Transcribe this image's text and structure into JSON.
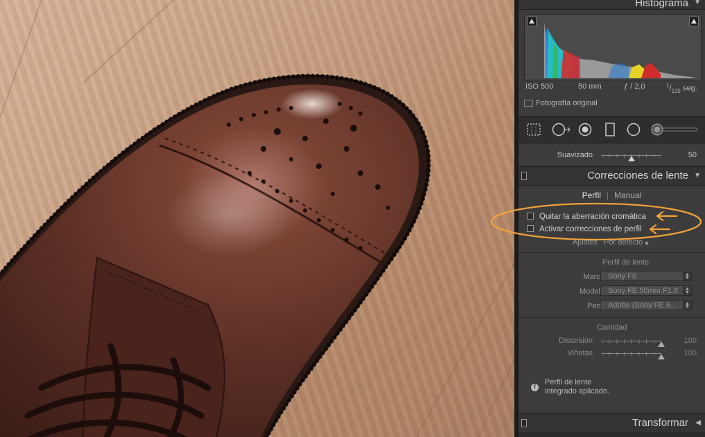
{
  "histogram": {
    "title": "Histograma",
    "iso": "ISO 500",
    "focal": "50 mm",
    "aperture": "ƒ / 2,0",
    "shutter_num": "1",
    "shutter_den": "125",
    "shutter_unit": "seg.",
    "original_photo_label": "Fotografía original"
  },
  "detail": {
    "smoothing_label": "Suavizado",
    "smoothing_value": "50",
    "smoothing_level": 0.5
  },
  "lens_corrections": {
    "title": "Correcciones de lente",
    "tabs": [
      "Perfil",
      "Manual"
    ],
    "active_tab": "Perfil",
    "tab_separator": "|",
    "remove_ca_label": "Quitar la aberración cromática",
    "enable_profile_label": "Activar correcciones de perfil",
    "settings_label": "Ajustes",
    "settings_value": "Por defecto",
    "settings_arrow": "◆",
    "profile_section": "Perfil de lente",
    "make_label": "Marca",
    "make_value": "Sony FE",
    "model_label": "Modelo",
    "model_value": "Sony FE 50mm F1.8",
    "profile_label": "Perfil",
    "profile_value": "Adobe (Sony FE 5...",
    "amount_section": "Cantidad",
    "distortion_label": "Distorsión",
    "distortion_value": "100",
    "vignetting_label": "Viñetas",
    "vignetting_value": "100",
    "info_line1": "Perfil de lente",
    "info_line2": "integrado aplicado."
  },
  "transform": {
    "title": "Transformar"
  },
  "colors": {
    "annotation": "#f4a33a",
    "panel": "#3c3c3c"
  },
  "icons": [
    "triangle-down-icon",
    "clip-warning-icon",
    "crop-grid-icon",
    "spot-removal-icon",
    "red-eye-icon",
    "graduated-filter-icon",
    "radial-filter-icon",
    "brush-icon",
    "info-icon"
  ]
}
